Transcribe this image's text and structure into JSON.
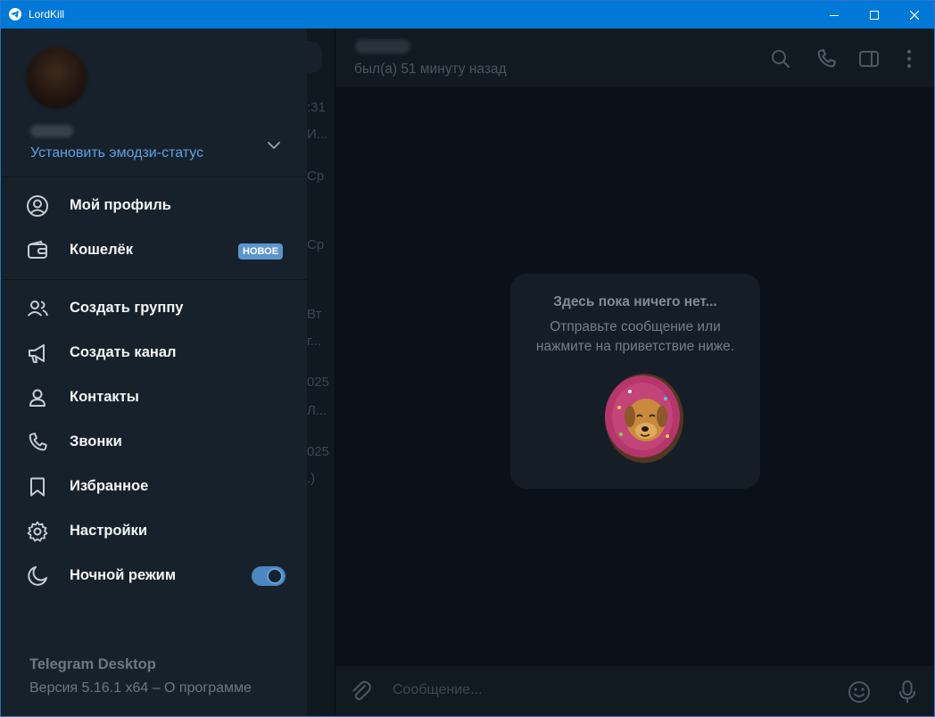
{
  "window": {
    "title": "LordKill"
  },
  "chat": {
    "status": "был(а) 51 минуту назад",
    "empty_title": "Здесь пока ничего нет...",
    "empty_line1": "Отправьте сообщение или",
    "empty_line2": "нажмите на приветствие ниже.",
    "composer_placeholder": "Сообщение..."
  },
  "chatlist_peek": ":31|И...|Ср|Ср|Вт|г...|025|Л...|025|.)",
  "drawer": {
    "emoji_status": "Установить эмодзи-статус",
    "items": [
      {
        "label": "Мой профиль",
        "icon": "profile-icon"
      },
      {
        "label": "Кошелёк",
        "icon": "wallet-icon",
        "badge": "НОВОЕ"
      },
      {
        "label": "Создать группу",
        "icon": "group-icon"
      },
      {
        "label": "Создать канал",
        "icon": "megaphone-icon"
      },
      {
        "label": "Контакты",
        "icon": "contact-icon"
      },
      {
        "label": "Звонки",
        "icon": "phone-icon"
      },
      {
        "label": "Избранное",
        "icon": "bookmark-icon"
      },
      {
        "label": "Настройки",
        "icon": "gear-icon"
      },
      {
        "label": "Ночной режим",
        "icon": "moon-icon",
        "toggle": true
      }
    ],
    "footer_title": "Telegram Desktop",
    "footer_version": "Версия 5.16.1 x64 – О программе"
  },
  "colors": {
    "accent": "#5ea3e0",
    "titlebar": "#0078d7",
    "drawer_bg": "#17212b",
    "badge": "#5c95cc"
  }
}
